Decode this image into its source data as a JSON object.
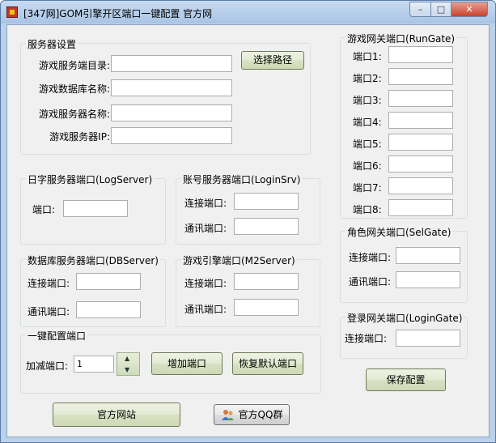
{
  "window": {
    "title": "[347网]GOM引擎开区端口一键配置  官方网",
    "minimize": "–",
    "maximize": "□",
    "close": "✕"
  },
  "server_settings": {
    "title": "服务器设置",
    "dir_label": "游戏服务端目录:",
    "db_label": "游戏数据库名称:",
    "name_label": "游戏服务器名称:",
    "ip_label": "游戏服务器IP:",
    "dir_value": "",
    "db_value": "",
    "name_value": "",
    "ip_value": "",
    "browse_button": "选择路径"
  },
  "log_server": {
    "title": "日字服务器端口(LogServer)",
    "port_label": "端口:",
    "port_value": ""
  },
  "login_srv": {
    "title": "账号服务器端口(LoginSrv)",
    "connect_label": "连接端口:",
    "comm_label": "通讯端口:"
  },
  "db_server": {
    "title": "数据库服务器端口(DBServer)",
    "connect_label": "连接端口:",
    "comm_label": "通讯端口:"
  },
  "m2_server": {
    "title": "游戏引擎端口(M2Server)",
    "connect_label": "连接端口:",
    "comm_label": "通讯端口:"
  },
  "one_click": {
    "title": "一键配置端口",
    "delta_label": "加减端口:",
    "delta_value": "1",
    "up": "▲",
    "down": "▼",
    "add_button": "增加端口",
    "restore_button": "恢复默认端口"
  },
  "run_gate": {
    "title": "游戏网关端口(RunGate)",
    "ports": [
      "端口1:",
      "端口2:",
      "端口3:",
      "端口4:",
      "端口5:",
      "端口6:",
      "端口7:",
      "端口8:"
    ]
  },
  "sel_gate": {
    "title": "角色网关端口(SelGate)",
    "connect_label": "连接端口:",
    "comm_label": "通讯端口:"
  },
  "login_gate": {
    "title": "登录网关端口(LoginGate)",
    "connect_label": "连接端口:"
  },
  "save_button": "保存配置",
  "website_button": "官方网站",
  "qq_button": "官方QQ群"
}
